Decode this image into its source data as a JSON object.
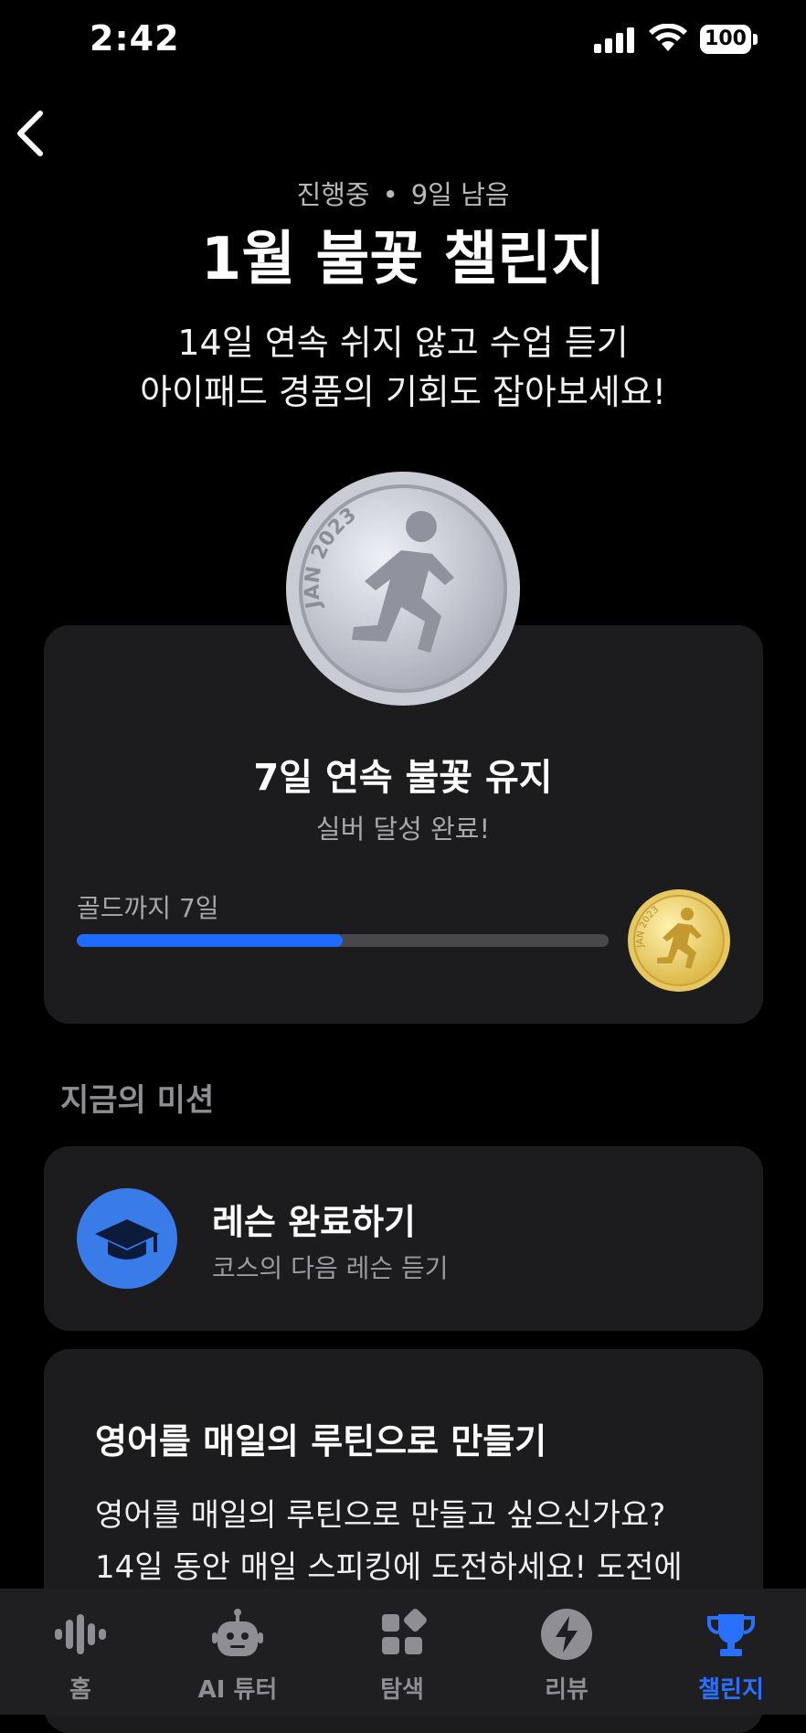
{
  "status_bar": {
    "time": "2:42",
    "battery": "100"
  },
  "header": {
    "status": "진행중",
    "separator": "•",
    "days_left": "9일 남음",
    "title": "1월 불꽃 챌린지",
    "description_line1": "14일 연속 쉬지 않고 수업 듣기",
    "description_line2": "아이패드 경품의 기회도 잡아보세요!"
  },
  "progress_card": {
    "medal_text": "JAN 2023",
    "title": "7일 연속 불꽃 유지",
    "subtitle": "실버 달성 완료!",
    "next_goal_label": "골드까지 7일",
    "progress": 0.5,
    "gold_medal_text": "JAN 2023"
  },
  "missions": {
    "section_title": "지금의 미션",
    "lesson": {
      "title": "레슨 완료하기",
      "subtitle": "코스의 다음 레슨 듣기",
      "icon": "graduation-cap-icon"
    }
  },
  "routine_card": {
    "title": "영어를 매일의 루틴으로 만들기",
    "body_line1": "영어를 매일의 루틴으로 만들고 싶으신가요?",
    "body_line2": "14일 동안 매일 스피킹에 도전하세요! 도전에"
  },
  "tab_bar": {
    "tabs": [
      {
        "label": "홈",
        "icon": "waveform-icon"
      },
      {
        "label": "AI 튜터",
        "icon": "robot-icon"
      },
      {
        "label": "탐색",
        "icon": "grid-icon"
      },
      {
        "label": "리뷰",
        "icon": "bolt-icon"
      },
      {
        "label": "챌린지",
        "icon": "trophy-icon"
      }
    ],
    "active_index": 4
  },
  "colors": {
    "accent": "#2a70ff",
    "card": "#1c1c1e",
    "mission_icon_bg": "#3a7bea"
  }
}
